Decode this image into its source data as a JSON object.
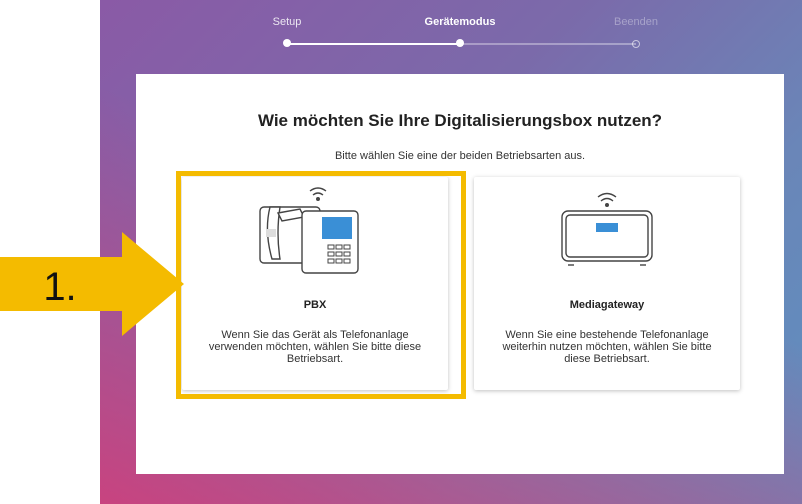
{
  "stepper": {
    "steps": [
      {
        "label": "Setup",
        "state": "done"
      },
      {
        "label": "Gerätemodus",
        "state": "active"
      },
      {
        "label": "Beenden",
        "state": "future"
      }
    ]
  },
  "page": {
    "title": "Wie möchten Sie Ihre Digitalisierungsbox nutzen?",
    "subtitle": "Bitte wählen Sie eine der beiden Betriebsarten aus."
  },
  "options": [
    {
      "title": "PBX",
      "description": "Wenn Sie das Gerät als Telefonanlage verwenden möchten, wählen Sie bitte diese Betriebsart.",
      "icon": "pbx-phone-icon",
      "selected": true
    },
    {
      "title": "Mediagateway",
      "description": "Wenn Sie eine bestehende Telefonanlage weiterhin nutzen möchten, wählen Sie bitte diese Betriebsart.",
      "icon": "mediagateway-icon",
      "selected": false
    }
  ],
  "callout": {
    "label": "1.",
    "color": "#f4bb00"
  },
  "colors": {
    "accent": "#f4bb00",
    "icon_screen": "#3a8fd6",
    "icon_stroke": "#444444"
  }
}
